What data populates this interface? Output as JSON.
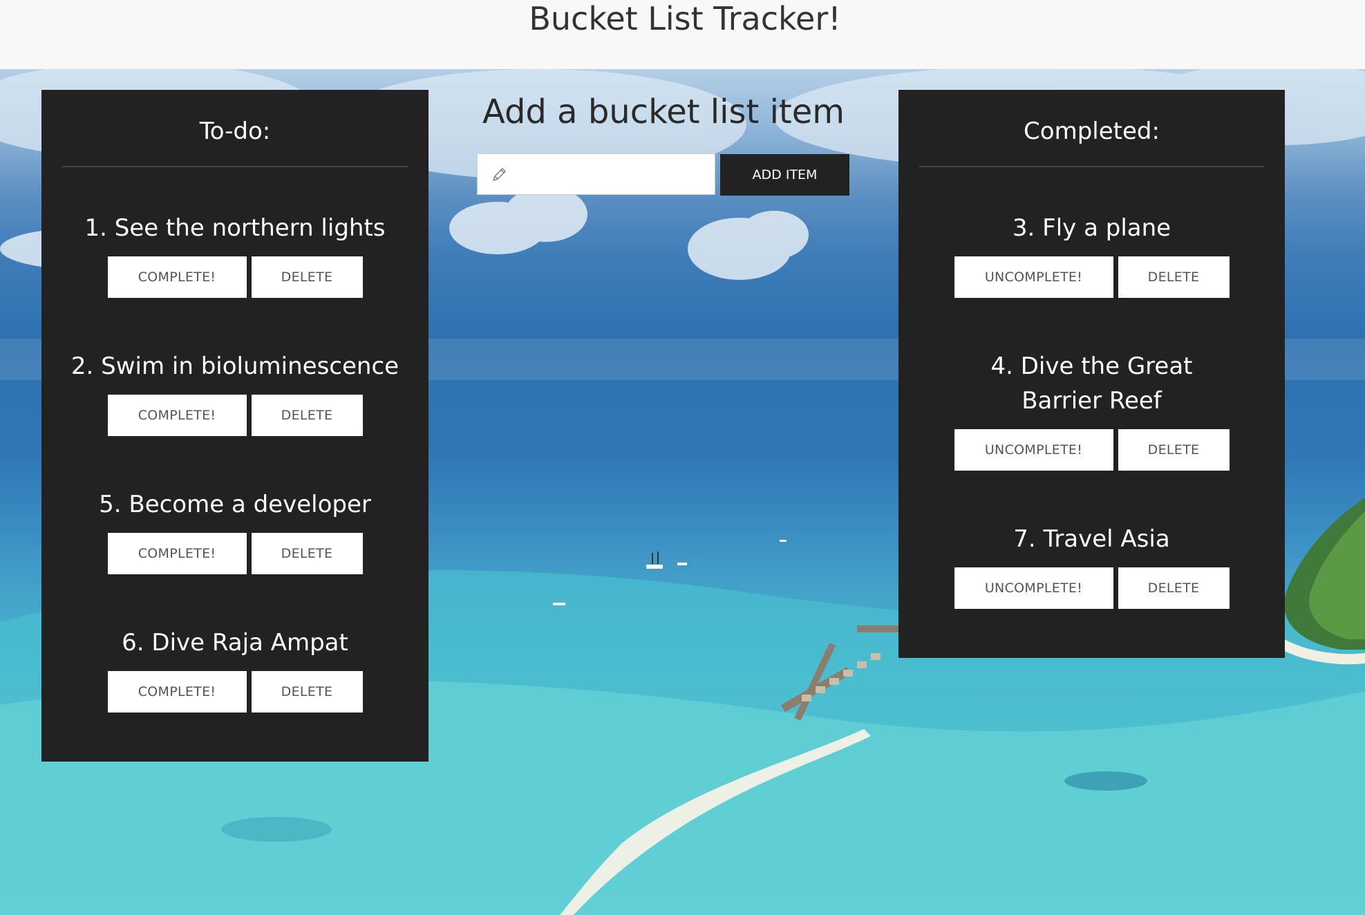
{
  "header": {
    "title": "Bucket List Tracker!"
  },
  "add_form": {
    "title": "Add a bucket list item",
    "input_value": "",
    "input_placeholder": "",
    "input_icon": "pencil-icon",
    "button_label": "ADD ITEM"
  },
  "todo": {
    "heading": "To-do:",
    "items": [
      {
        "label": "1. See the northern lights",
        "action_label": "COMPLETE!",
        "delete_label": "DELETE"
      },
      {
        "label": "2. Swim in bioluminescence",
        "action_label": "COMPLETE!",
        "delete_label": "DELETE"
      },
      {
        "label": "5. Become a developer",
        "action_label": "COMPLETE!",
        "delete_label": "DELETE"
      },
      {
        "label": "6. Dive Raja Ampat",
        "action_label": "COMPLETE!",
        "delete_label": "DELETE"
      }
    ]
  },
  "completed": {
    "heading": "Completed:",
    "items": [
      {
        "label": "3. Fly a plane",
        "action_label": "UNCOMPLETE!",
        "delete_label": "DELETE"
      },
      {
        "label": "4. Dive the Great Barrier Reef",
        "action_label": "UNCOMPLETE!",
        "delete_label": "DELETE"
      },
      {
        "label": "7. Travel Asia",
        "action_label": "UNCOMPLETE!",
        "delete_label": "DELETE"
      }
    ]
  },
  "colors": {
    "header_bg": "#f8f8f8",
    "panel_bg": "#222222",
    "button_bg": "#ffffff",
    "add_button_bg": "#222222"
  }
}
